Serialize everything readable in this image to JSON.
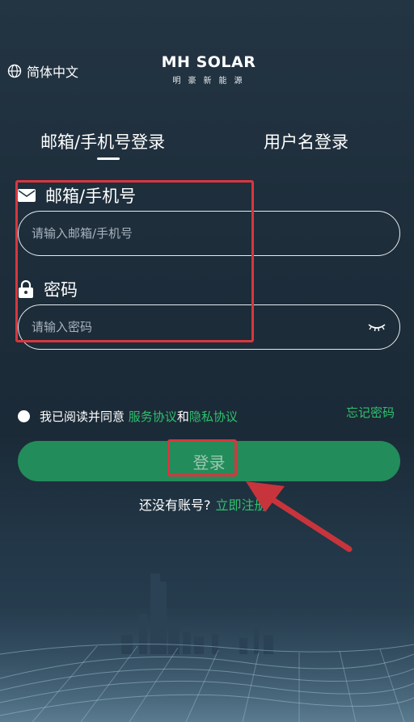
{
  "header": {
    "language_label": "简体中文",
    "logo_text": "MH SOLAR",
    "logo_subtitle": "明豪新能源"
  },
  "tabs": [
    {
      "label": "邮箱/手机号登录",
      "active": true
    },
    {
      "label": "用户名登录",
      "active": false
    }
  ],
  "form": {
    "email_label": "邮箱/手机号",
    "email_placeholder": "请输入邮箱/手机号",
    "email_value": "",
    "password_label": "密码",
    "password_placeholder": "请输入密码",
    "password_value": ""
  },
  "agreement": {
    "prefix": "我已阅读并同意",
    "service_link": "服务协议",
    "and": "和",
    "privacy_link": "隐私协议",
    "checked": false
  },
  "forgot_password": "忘记密码",
  "login_button": "登录",
  "register": {
    "prompt": "还没有账号?",
    "link": "立即注册"
  },
  "colors": {
    "accent_green": "#2fc06d",
    "button_green": "#238c5b",
    "annotation_red": "#d9363e",
    "background": "#1d2d3a"
  },
  "icons": [
    "globe-icon",
    "mail-icon",
    "lock-icon",
    "eye-closed-icon",
    "logo-grid-icon"
  ]
}
